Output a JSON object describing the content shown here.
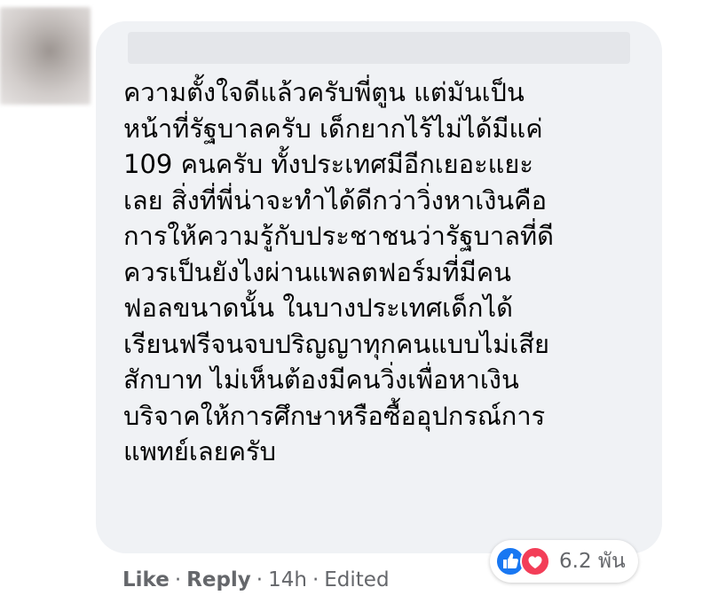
{
  "comment": {
    "text": "ความตั้งใจดีแล้วครับพี่ตูน แต่มันเป็น\nหน้าที่รัฐบาลครับ เด็กยากไร้ไม่ได้มีแค่\n109 คนครับ ทั้งประเทศมีอีกเยอะแยะ\nเลย สิ่งที่พี่น่าจะทำได้ดีกว่าวิ่งหาเงินคือ\nการให้ความรู้กับประชาชนว่ารัฐบาลที่ดี\nควรเป็นยังไงผ่านแพลตฟอร์มที่มีคน\nฟอลขนาดนั้น ในบางประเทศเด็กได้\nเรียนฟรีจนจบปริญญาทุกคนแบบไม่เสีย\nสักบาท ไม่เห็นต้องมีคนวิ่งเพื่อหาเงิน\nบริจาคให้การศึกษาหรือซื้ออุปกรณ์การ\nแพทย์เลยครับ"
  },
  "reactions": {
    "icons": [
      "like-icon",
      "love-icon"
    ],
    "count": "6.2 พัน",
    "colors": {
      "like": "#1877f2",
      "love": "#f33e58"
    }
  },
  "actions": {
    "like_label": "Like",
    "separator": "·",
    "reply_label": "Reply",
    "time": "14h",
    "edited_label": "Edited"
  },
  "colors": {
    "bubble_bg": "#f0f2f5",
    "text": "#050505",
    "secondary_text": "#65676b"
  }
}
